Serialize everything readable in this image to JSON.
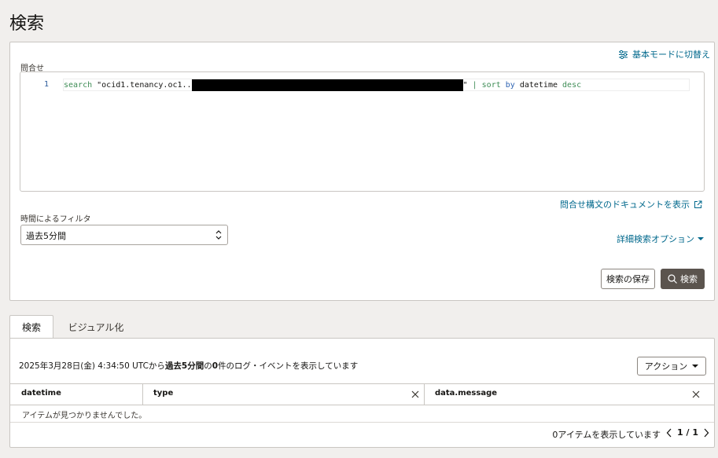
{
  "page": {
    "title": "検索"
  },
  "query": {
    "label": "問合せ",
    "basic_mode_label": "基本モードに切替え",
    "line_number": "1",
    "code": {
      "search_kw": "search",
      "string_start": " \"ocid1.tenancy.oc1..",
      "string_end": "\" ",
      "pipe": "|",
      "sort_kw": " sort ",
      "by_kw": "by",
      "field": " datetime ",
      "desc_kw": "desc"
    },
    "doc_link_label": "問合せ構文のドキュメントを表示"
  },
  "filter": {
    "label": "時間によるフィルタ",
    "selected": "過去5分間",
    "advanced_label": "詳細検索オプション"
  },
  "buttons": {
    "save_label": "検索の保存",
    "search_label": "検索"
  },
  "tabs": [
    {
      "label": "検索",
      "active": true
    },
    {
      "label": "ビジュアル化",
      "active": false
    }
  ],
  "results": {
    "summary_prefix": "2025年3月28日(金) 4:34:50 UTCから",
    "summary_range": "過去5分間",
    "summary_mid": "の",
    "summary_count": "0",
    "summary_suffix": "件のログ・イベントを表示しています",
    "action_label": "アクション",
    "columns": [
      "datetime",
      "type",
      "data.message"
    ],
    "empty_message": "アイテムが見つかりませんでした。",
    "items_shown": "0アイテムを表示しています",
    "page_info": "1 / 1"
  },
  "colors": {
    "link": "#00688c",
    "primary_button": "#5b544e",
    "background": "#f1efed"
  },
  "icons": [
    "sliders-icon",
    "external-link-icon",
    "caret-down-icon",
    "search-icon",
    "close-icon",
    "chevron-left-icon",
    "chevron-right-icon",
    "updown-arrows-icon"
  ]
}
